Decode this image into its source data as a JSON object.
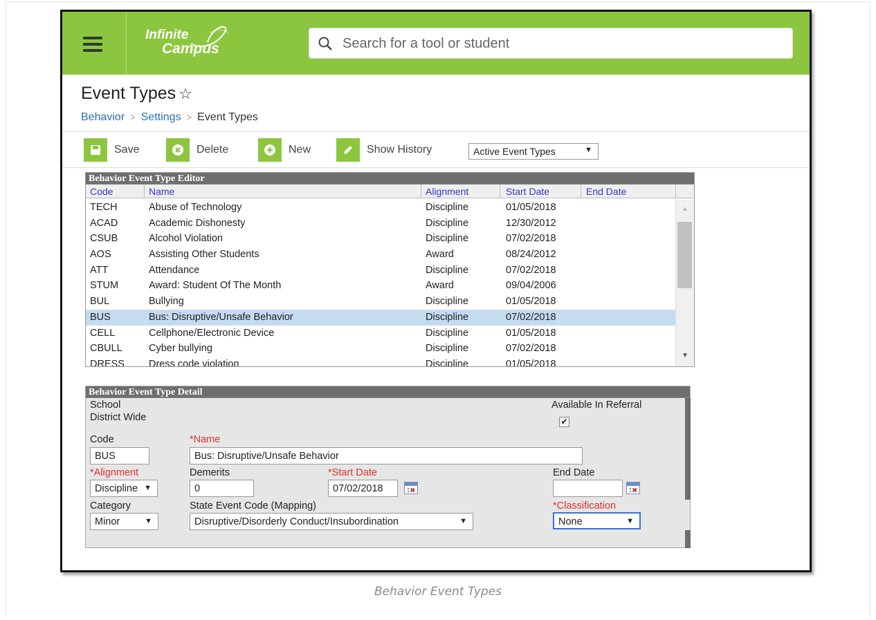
{
  "header": {
    "logo_line1": "Infinite",
    "logo_line2": "Campus",
    "search_placeholder": "Search for a tool or student"
  },
  "page": {
    "title": "Event Types",
    "breadcrumb": [
      "Behavior",
      "Settings",
      "Event Types"
    ]
  },
  "toolbar": {
    "save": "Save",
    "delete": "Delete",
    "new": "New",
    "history": "Show History",
    "filter_value": "Active Event Types"
  },
  "editor": {
    "title": "Behavior Event Type Editor",
    "columns": {
      "code": "Code",
      "name": "Name",
      "alignment": "Alignment",
      "start": "Start Date",
      "end": "End Date"
    },
    "rows": [
      {
        "code": "TECH",
        "name": "Abuse of Technology",
        "alignment": "Discipline",
        "start": "01/05/2018",
        "end": ""
      },
      {
        "code": "ACAD",
        "name": "Academic Dishonesty",
        "alignment": "Discipline",
        "start": "12/30/2012",
        "end": ""
      },
      {
        "code": "CSUB",
        "name": "Alcohol Violation",
        "alignment": "Discipline",
        "start": "07/02/2018",
        "end": ""
      },
      {
        "code": "AOS",
        "name": "Assisting Other Students",
        "alignment": "Award",
        "start": "08/24/2012",
        "end": ""
      },
      {
        "code": "ATT",
        "name": "Attendance",
        "alignment": "Discipline",
        "start": "07/02/2018",
        "end": ""
      },
      {
        "code": "STUM",
        "name": "Award: Student Of The Month",
        "alignment": "Award",
        "start": "09/04/2006",
        "end": ""
      },
      {
        "code": "BUL",
        "name": "Bullying",
        "alignment": "Discipline",
        "start": "01/05/2018",
        "end": ""
      },
      {
        "code": "BUS",
        "name": "Bus: Disruptive/Unsafe Behavior",
        "alignment": "Discipline",
        "start": "07/02/2018",
        "end": "",
        "selected": true
      },
      {
        "code": "CELL",
        "name": "Cellphone/Electronic Device",
        "alignment": "Discipline",
        "start": "01/05/2018",
        "end": ""
      },
      {
        "code": "CBULL",
        "name": "Cyber bullying",
        "alignment": "Discipline",
        "start": "07/02/2018",
        "end": ""
      },
      {
        "code": "DRESS",
        "name": "Dress code violation",
        "alignment": "Discipline",
        "start": "01/05/2018",
        "end": ""
      }
    ]
  },
  "detail": {
    "title": "Behavior Event Type Detail",
    "school_label": "School",
    "school_value": "District Wide",
    "referral_label": "Available In Referral",
    "referral_checked": true,
    "code_label": "Code",
    "code_value": "BUS",
    "name_label": "*Name",
    "name_value": "Bus: Disruptive/Unsafe Behavior",
    "alignment_label": "*Alignment",
    "alignment_value": "Discipline",
    "demerits_label": "Demerits",
    "demerits_value": "0",
    "start_label": "*Start Date",
    "start_value": "07/02/2018",
    "end_label": "End Date",
    "end_value": "",
    "category_label": "Category",
    "category_value": "Minor",
    "state_label": "State Event Code (Mapping)",
    "state_value": "Disruptive/Disorderly Conduct/Insubordination",
    "class_label": "*Classification",
    "class_value": "None"
  },
  "caption": "Behavior Event Types",
  "colors": {
    "brand_green": "#8cc63f",
    "link_blue": "#2a6ebb",
    "selected_row": "#c6dbf0",
    "required_red": "#e03030"
  }
}
